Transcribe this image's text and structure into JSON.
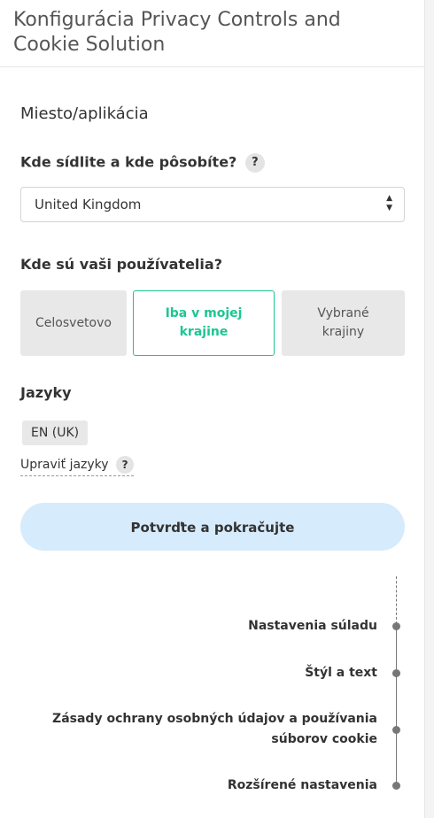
{
  "header": {
    "title": "Konfigurácia Privacy Controls and Cookie Solution"
  },
  "place": {
    "section_title": "Miesto/aplikácia",
    "location_question": "Kde sídlite a kde pôsobíte?",
    "help_glyph": "?",
    "country_value": "United Kingdom",
    "users_question": "Kde sú vaši používatelia?",
    "options": [
      {
        "label": "Celosvetovo",
        "selected": false
      },
      {
        "label": "Iba v mojej krajine",
        "selected": true
      },
      {
        "label": "Vybrané krajiny",
        "selected": false
      }
    ]
  },
  "languages": {
    "label": "Jazyky",
    "items": [
      "EN (UK)"
    ],
    "edit_link": "Upraviť jazyky"
  },
  "confirm_button": "Potvrďte a pokračujte",
  "steps": [
    "Nastavenia súladu",
    "Štýl a text",
    "Zásady ochrany osobných údajov a používania súborov cookie",
    "Rozšírené nastavenia"
  ],
  "colors": {
    "accent_green": "#1cc691",
    "button_blue": "#d6ebfb",
    "option_gray": "#e8e8e8"
  }
}
